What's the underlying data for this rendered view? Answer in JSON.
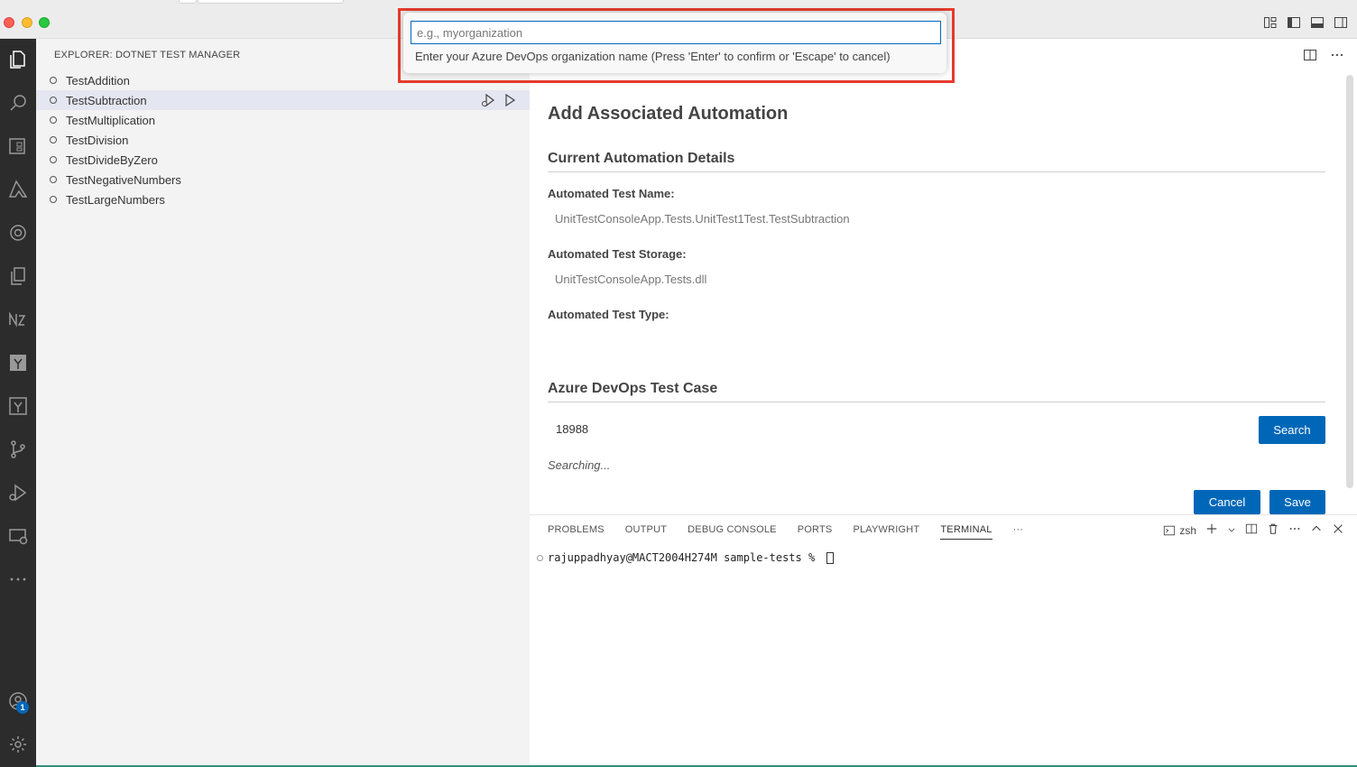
{
  "quickpick": {
    "placeholder": "e.g., myorganization",
    "message": "Enter your Azure DevOps organization name (Press 'Enter' to confirm or 'Escape' to cancel)"
  },
  "sidebar": {
    "title": "EXPLORER: DOTNET TEST MANAGER",
    "tests": [
      {
        "label": "TestAddition"
      },
      {
        "label": "TestSubtraction",
        "selected": true
      },
      {
        "label": "TestMultiplication"
      },
      {
        "label": "TestDivision"
      },
      {
        "label": "TestDivideByZero"
      },
      {
        "label": "TestNegativeNumbers"
      },
      {
        "label": "TestLargeNumbers"
      }
    ]
  },
  "editor": {
    "title": "Add Associated Automation",
    "current_section": "Current Automation Details",
    "test_name_label": "Automated Test Name:",
    "test_name_value": "UnitTestConsoleApp.Tests.UnitTest1Test.TestSubtraction",
    "test_storage_label": "Automated Test Storage:",
    "test_storage_value": "UnitTestConsoleApp.Tests.dll",
    "test_type_label": "Automated Test Type:",
    "devops_section": "Azure DevOps Test Case",
    "test_case_id": "18988",
    "search_button": "Search",
    "status": "Searching...",
    "cancel_button": "Cancel",
    "save_button": "Save"
  },
  "panel": {
    "tabs": [
      "PROBLEMS",
      "OUTPUT",
      "DEBUG CONSOLE",
      "PORTS",
      "PLAYWRIGHT",
      "TERMINAL"
    ],
    "active_tab": "TERMINAL",
    "more": "···",
    "shell": "zsh",
    "prompt": "rajuppadhyay@MACT2004H274M sample-tests % "
  },
  "activity": {
    "accounts_badge": "1"
  },
  "colors": {
    "accent": "#0067b8",
    "highlight_outline": "#e53b2e",
    "activitybar": "#2c2c2c",
    "sidebar": "#f3f3f3"
  },
  "icons": [
    "explorer-icon",
    "search-icon",
    "test-manager-icon",
    "azure-icon",
    "openai-icon",
    "copy-icon",
    "n8n-icon",
    "azure-pipelines-icon",
    "azure-repos-icon",
    "source-control-icon",
    "run-debug-icon",
    "remote-explorer-icon",
    "more-icon",
    "accounts-icon",
    "settings-gear-icon"
  ]
}
